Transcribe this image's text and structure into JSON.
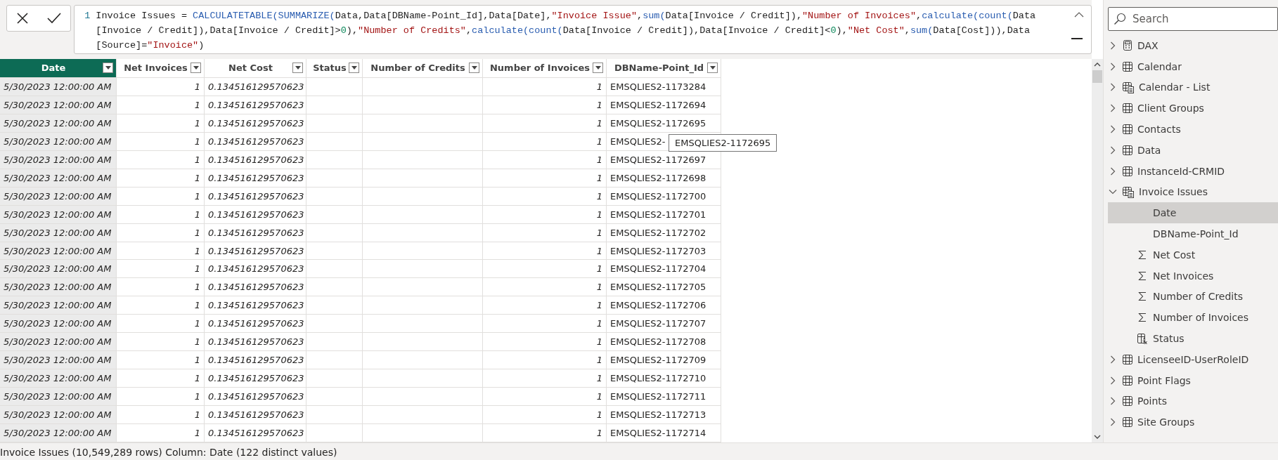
{
  "formula_bar": {
    "line_number": "1",
    "lines": [
      [
        {
          "text": "Invoice Issues = ",
          "kind": "plain"
        },
        {
          "text": "CALCULATETABLE(SUMMARIZE(",
          "kind": "func"
        },
        {
          "text": "Data,Data[DBName-Point_Id],Data[Date],",
          "kind": "plain"
        },
        {
          "text": "\"Invoice Issue\"",
          "kind": "string"
        },
        {
          "text": ",",
          "kind": "plain"
        },
        {
          "text": "sum(",
          "kind": "func"
        },
        {
          "text": "Data[Invoice / Credit]),",
          "kind": "plain"
        },
        {
          "text": "\"Number of Invoices\"",
          "kind": "string"
        },
        {
          "text": ",",
          "kind": "plain"
        },
        {
          "text": "calculate(count(",
          "kind": "func"
        },
        {
          "text": "Data",
          "kind": "plain"
        }
      ],
      [
        {
          "text": "[Invoice / Credit]),Data[Invoice / Credit]>",
          "kind": "plain"
        },
        {
          "text": "0",
          "kind": "number"
        },
        {
          "text": "),",
          "kind": "plain"
        },
        {
          "text": "\"Number of Credits\"",
          "kind": "string"
        },
        {
          "text": ",",
          "kind": "plain"
        },
        {
          "text": "calculate(count(",
          "kind": "func"
        },
        {
          "text": "Data[Invoice / Credit]),Data[Invoice / Credit]<",
          "kind": "plain"
        },
        {
          "text": "0",
          "kind": "number"
        },
        {
          "text": "),",
          "kind": "plain"
        },
        {
          "text": "\"Net Cost\"",
          "kind": "string"
        },
        {
          "text": ",",
          "kind": "plain"
        },
        {
          "text": "sum(",
          "kind": "func"
        },
        {
          "text": "Data[Cost])),Data",
          "kind": "plain"
        }
      ],
      [
        {
          "text": "[Source]=",
          "kind": "plain"
        },
        {
          "text": "\"Invoice\"",
          "kind": "string"
        },
        {
          "text": ")",
          "kind": "plain"
        }
      ]
    ]
  },
  "table": {
    "columns": [
      {
        "name": "Date",
        "selected": true,
        "kind": "datetime"
      },
      {
        "name": "Net Invoices",
        "selected": false,
        "kind": "integer"
      },
      {
        "name": "Net Cost",
        "selected": false,
        "kind": "decimal"
      },
      {
        "name": "Status",
        "selected": false,
        "kind": "text"
      },
      {
        "name": "Number of Credits",
        "selected": false,
        "kind": "integer"
      },
      {
        "name": "Number of Invoices",
        "selected": false,
        "kind": "integer"
      },
      {
        "name": "DBName-Point_Id",
        "selected": false,
        "kind": "text"
      }
    ],
    "rows": [
      [
        "5/30/2023 12:00:00 AM",
        "1",
        "0.134516129570623",
        "",
        "",
        "1",
        "EMSQLIES2-1173284"
      ],
      [
        "5/30/2023 12:00:00 AM",
        "1",
        "0.134516129570623",
        "",
        "",
        "1",
        "EMSQLIES2-1172694"
      ],
      [
        "5/30/2023 12:00:00 AM",
        "1",
        "0.134516129570623",
        "",
        "",
        "1",
        "EMSQLIES2-1172695"
      ],
      [
        "5/30/2023 12:00:00 AM",
        "1",
        "0.134516129570623",
        "",
        "",
        "1",
        "EMSQLIES2-"
      ],
      [
        "5/30/2023 12:00:00 AM",
        "1",
        "0.134516129570623",
        "",
        "",
        "1",
        "EMSQLIES2-1172697"
      ],
      [
        "5/30/2023 12:00:00 AM",
        "1",
        "0.134516129570623",
        "",
        "",
        "1",
        "EMSQLIES2-1172698"
      ],
      [
        "5/30/2023 12:00:00 AM",
        "1",
        "0.134516129570623",
        "",
        "",
        "1",
        "EMSQLIES2-1172700"
      ],
      [
        "5/30/2023 12:00:00 AM",
        "1",
        "0.134516129570623",
        "",
        "",
        "1",
        "EMSQLIES2-1172701"
      ],
      [
        "5/30/2023 12:00:00 AM",
        "1",
        "0.134516129570623",
        "",
        "",
        "1",
        "EMSQLIES2-1172702"
      ],
      [
        "5/30/2023 12:00:00 AM",
        "1",
        "0.134516129570623",
        "",
        "",
        "1",
        "EMSQLIES2-1172703"
      ],
      [
        "5/30/2023 12:00:00 AM",
        "1",
        "0.134516129570623",
        "",
        "",
        "1",
        "EMSQLIES2-1172704"
      ],
      [
        "5/30/2023 12:00:00 AM",
        "1",
        "0.134516129570623",
        "",
        "",
        "1",
        "EMSQLIES2-1172705"
      ],
      [
        "5/30/2023 12:00:00 AM",
        "1",
        "0.134516129570623",
        "",
        "",
        "1",
        "EMSQLIES2-1172706"
      ],
      [
        "5/30/2023 12:00:00 AM",
        "1",
        "0.134516129570623",
        "",
        "",
        "1",
        "EMSQLIES2-1172707"
      ],
      [
        "5/30/2023 12:00:00 AM",
        "1",
        "0.134516129570623",
        "",
        "",
        "1",
        "EMSQLIES2-1172708"
      ],
      [
        "5/30/2023 12:00:00 AM",
        "1",
        "0.134516129570623",
        "",
        "",
        "1",
        "EMSQLIES2-1172709"
      ],
      [
        "5/30/2023 12:00:00 AM",
        "1",
        "0.134516129570623",
        "",
        "",
        "1",
        "EMSQLIES2-1172710"
      ],
      [
        "5/30/2023 12:00:00 AM",
        "1",
        "0.134516129570623",
        "",
        "",
        "1",
        "EMSQLIES2-1172711"
      ],
      [
        "5/30/2023 12:00:00 AM",
        "1",
        "0.134516129570623",
        "",
        "",
        "1",
        "EMSQLIES2-1172713"
      ],
      [
        "5/30/2023 12:00:00 AM",
        "1",
        "0.134516129570623",
        "",
        "",
        "1",
        "EMSQLIES2-1172714"
      ]
    ],
    "tooltip": {
      "text": "EMSQLIES2-1172695"
    }
  },
  "sidebar": {
    "search": {
      "placeholder": "Search"
    },
    "tables": [
      {
        "name": "DAX",
        "kind": "measures",
        "expanded": false
      },
      {
        "name": "Calendar",
        "kind": "table",
        "expanded": false
      },
      {
        "name": "Calendar - List",
        "kind": "calc-table",
        "expanded": false
      },
      {
        "name": "Client Groups",
        "kind": "table",
        "expanded": false
      },
      {
        "name": "Contacts",
        "kind": "table",
        "expanded": false
      },
      {
        "name": "Data",
        "kind": "table",
        "expanded": false
      },
      {
        "name": "InstanceId-CRMID",
        "kind": "table",
        "expanded": false
      },
      {
        "name": "Invoice Issues",
        "kind": "calc-table",
        "expanded": true,
        "children": [
          {
            "name": "Date",
            "kind": "column",
            "selected": true
          },
          {
            "name": "DBName-Point_Id",
            "kind": "column",
            "selected": false
          },
          {
            "name": "Net Cost",
            "kind": "sum",
            "selected": false
          },
          {
            "name": "Net Invoices",
            "kind": "sum",
            "selected": false
          },
          {
            "name": "Number of Credits",
            "kind": "sum",
            "selected": false
          },
          {
            "name": "Number of Invoices",
            "kind": "sum",
            "selected": false
          },
          {
            "name": "Status",
            "kind": "calc-column",
            "selected": false
          }
        ]
      },
      {
        "name": "LicenseeID-UserRoleID",
        "kind": "table",
        "expanded": false
      },
      {
        "name": "Point Flags",
        "kind": "table",
        "expanded": false
      },
      {
        "name": "Points",
        "kind": "table",
        "expanded": false
      },
      {
        "name": "Site Groups",
        "kind": "table",
        "expanded": false
      }
    ]
  },
  "status_bar": {
    "text": "Invoice Issues (10,549,289 rows) Column: Date (122 distinct values)"
  }
}
